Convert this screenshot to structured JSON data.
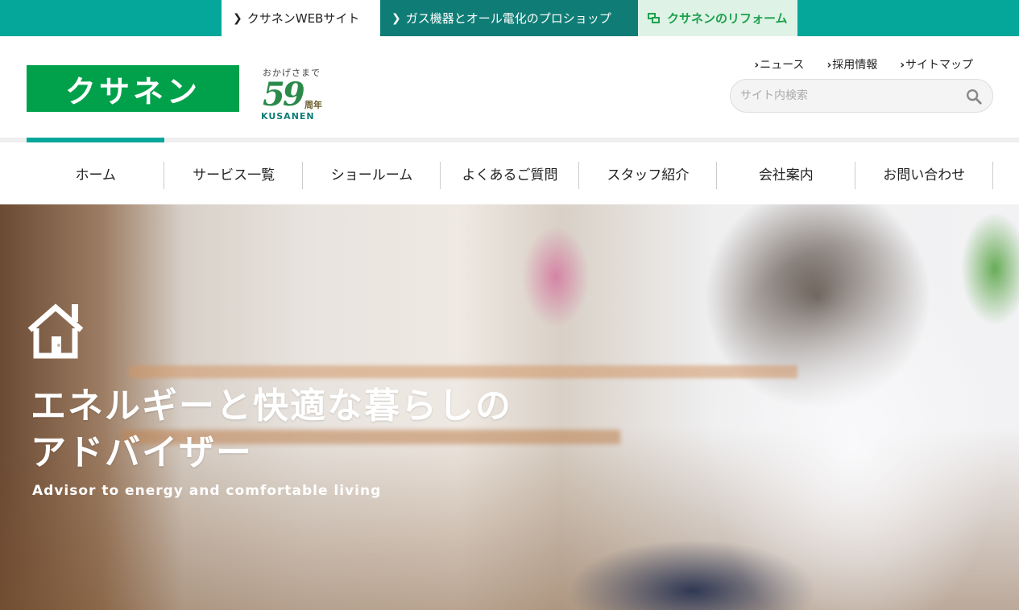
{
  "topbar": {
    "tabs": [
      {
        "label": "クサネンWEBサイト",
        "icon": "chevron-right-icon"
      },
      {
        "label": "ガス機器とオール電化のプロショップ",
        "icon": "chevron-right-icon"
      },
      {
        "label": "クサネンのリフォーム",
        "icon": "window-icon"
      }
    ],
    "colors": {
      "bar": "#04a79a",
      "dark": "#0f7d76",
      "reform": "#1da14d"
    }
  },
  "header": {
    "logo_text": "クサネン",
    "anniversary": {
      "tagline": "おかげさまで",
      "years": "59",
      "unit": "周年",
      "brand": "KUSANEN"
    },
    "links": [
      {
        "label": "ニュース"
      },
      {
        "label": "採用情報"
      },
      {
        "label": "サイトマップ"
      }
    ],
    "search": {
      "placeholder": "サイト内検索",
      "value": "",
      "icon": "search-icon"
    }
  },
  "nav": {
    "items": [
      {
        "label": "ホーム"
      },
      {
        "label": "サービス一覧"
      },
      {
        "label": "ショールーム"
      },
      {
        "label": "よくあるご質問"
      },
      {
        "label": "スタッフ紹介"
      },
      {
        "label": "会社案内"
      },
      {
        "label": "お問い合わせ"
      }
    ],
    "active_index": 0,
    "accent": "#04a79a"
  },
  "hero": {
    "icon": "house-icon",
    "title_line1": "エネルギーと快適な暮らしの",
    "title_line2": "アドバイザー",
    "subtitle": "Advisor to energy and comfortable living"
  }
}
